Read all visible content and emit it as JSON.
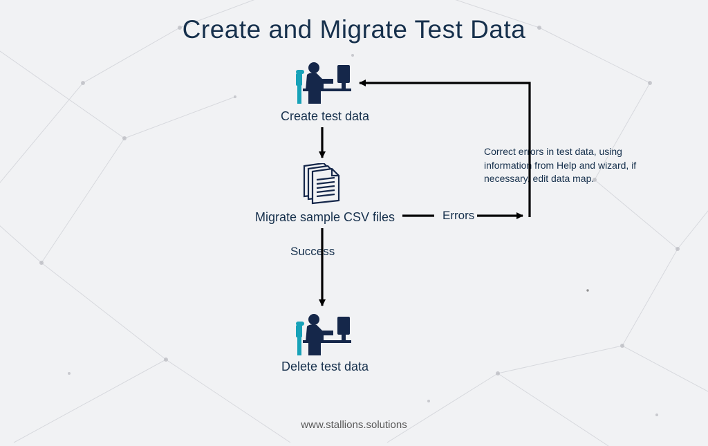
{
  "title": "Create and Migrate Test Data",
  "nodes": {
    "create": "Create test data",
    "migrate": "Migrate sample CSV files",
    "delete": "Delete test data"
  },
  "branches": {
    "success": "Success",
    "errors": "Errors"
  },
  "annotation": "Correct errors in test data, using information from Help and wizard, if necessary, edit data map.",
  "footer": "www.stallions.solutions",
  "colors": {
    "title": "#16304c",
    "text": "#16304c",
    "iconDark": "#15274a",
    "iconLight": "#17a2b8",
    "footer": "#595959"
  }
}
